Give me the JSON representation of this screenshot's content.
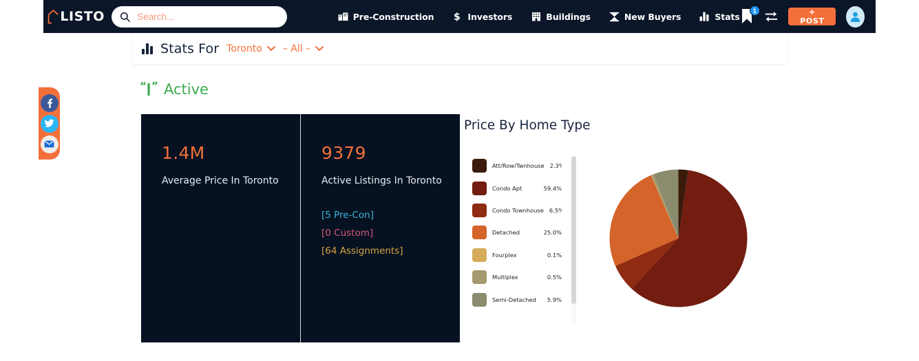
{
  "navbar": {
    "logo_text": "LISTO",
    "logo_icon": "house-outline-icon",
    "search": {
      "placeholder": "Search...",
      "value": "",
      "icon": "search-icon"
    },
    "links": [
      {
        "label": "Pre-Construction",
        "icon": "buildings-icon"
      },
      {
        "label": "Investors",
        "icon": "dollar-icon"
      },
      {
        "label": "Buildings",
        "icon": "building-icon"
      },
      {
        "label": "New Buyers",
        "icon": "new-buyers-icon"
      },
      {
        "label": "Stats",
        "icon": "bar-chart-icon"
      }
    ],
    "bookmark": {
      "icon": "bookmark-icon",
      "badge_count": "1"
    },
    "compare": {
      "icon": "compare-arrows-icon"
    },
    "post_button": {
      "label": "+ POST",
      "color": "#f4703a"
    },
    "avatar": {
      "icon": "user-avatar-icon"
    },
    "bg_color": "#0b1628"
  },
  "social_rail": {
    "bg_color": "#f4703a",
    "items": [
      {
        "name": "facebook",
        "icon": "facebook-icon",
        "color": "#3b5998"
      },
      {
        "name": "twitter",
        "icon": "twitter-icon",
        "color": "#29b6f6"
      },
      {
        "name": "email",
        "icon": "envelope-icon",
        "color": "#f0eeea"
      }
    ]
  },
  "stats_bar": {
    "icon": "bar-chart-icon",
    "title": "Stats For",
    "city_filter": "Toronto",
    "type_filter": "– All –",
    "accent_color": "#f4703a"
  },
  "active_section": {
    "icon": "broadcast-signal-icon",
    "label": "Active",
    "color": "#3aab4e"
  },
  "cards": [
    {
      "value": "1.4M",
      "label": "Average Price In Toronto",
      "links": []
    },
    {
      "value": "9379",
      "label": "Active Listings In Toronto",
      "links": [
        {
          "text": "[5 Pre-Con]",
          "color": "#3ab3d8"
        },
        {
          "text": "[0 Custom]",
          "color": "#d4577a"
        },
        {
          "text": "[64 Assignments]",
          "color": "#d9a441"
        }
      ]
    }
  ],
  "chart_data": {
    "type": "pie",
    "title": "Price By Home Type",
    "categories": [
      "Att/Row/Twnhouse",
      "Condo Apt",
      "Condo Townhouse",
      "Detached",
      "Fourplex",
      "Multiplex",
      "Semi-Detached"
    ],
    "values": [
      2.3,
      59.4,
      6.5,
      25.0,
      0.1,
      0.5,
      5.9
    ],
    "labels": [
      "2.3%",
      "59.4%",
      "6.5%",
      "25.0%",
      "0.1%",
      "0.5%",
      "5.9%"
    ],
    "colors": [
      "#3b1a0c",
      "#731c10",
      "#8f2b10",
      "#d4642a",
      "#d5ab5c",
      "#a49a6d",
      "#8b8c6e"
    ],
    "legend_position": "left",
    "start_angle": 0,
    "direction": "clockwise"
  }
}
